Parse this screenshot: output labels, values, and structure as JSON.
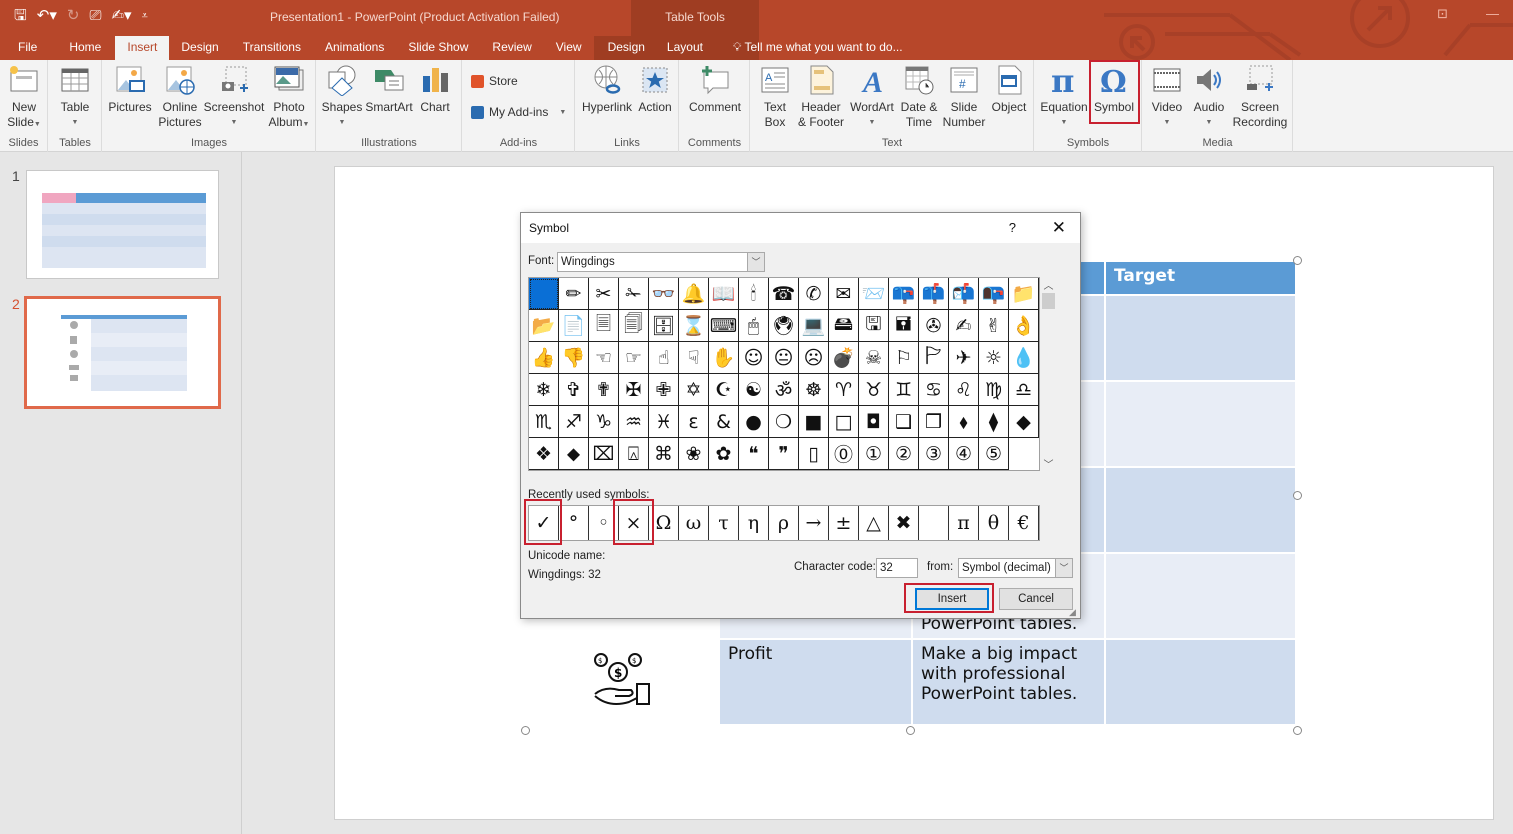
{
  "window": {
    "title": "Presentation1 - PowerPoint (Product Activation Failed)",
    "contextual_group": "Table Tools",
    "accent_color": "#b7472a"
  },
  "quick_access": [
    "save-icon",
    "undo-icon",
    "redo-icon",
    "start-from-beginning-icon",
    "touch-mode-icon",
    "customize-icon"
  ],
  "tabs": [
    {
      "label": "File"
    },
    {
      "label": "Home"
    },
    {
      "label": "Insert",
      "active": true
    },
    {
      "label": "Design"
    },
    {
      "label": "Transitions"
    },
    {
      "label": "Animations"
    },
    {
      "label": "Slide Show"
    },
    {
      "label": "Review"
    },
    {
      "label": "View"
    },
    {
      "label": "Design"
    },
    {
      "label": "Layout"
    }
  ],
  "tell_me": "Tell me what you want to do...",
  "ribbon": {
    "groups": {
      "slides": "Slides",
      "tables": "Tables",
      "images": "Images",
      "illustrations": "Illustrations",
      "addins": "Add-ins",
      "links": "Links",
      "comments": "Comments",
      "text": "Text",
      "symbols": "Symbols",
      "media": "Media"
    },
    "buttons": {
      "new_slide": [
        "New",
        "Slide"
      ],
      "table": "Table",
      "pictures": "Pictures",
      "online_pictures": [
        "Online",
        "Pictures"
      ],
      "screenshot": "Screenshot",
      "photo_album": [
        "Photo",
        "Album"
      ],
      "shapes": "Shapes",
      "smartart": "SmartArt",
      "chart": "Chart",
      "store": "Store",
      "my_addins": "My Add-ins",
      "hyperlink": "Hyperlink",
      "action": "Action",
      "comment": "Comment",
      "text_box": [
        "Text",
        "Box"
      ],
      "header_footer": [
        "Header",
        "& Footer"
      ],
      "wordart": "WordArt",
      "date_time": [
        "Date &",
        "Time"
      ],
      "slide_number": [
        "Slide",
        "Number"
      ],
      "object": "Object",
      "equation": "Equation",
      "symbol": "Symbol",
      "video": "Video",
      "audio": "Audio",
      "screen_recording": [
        "Screen",
        "Recording"
      ]
    }
  },
  "slides_pane": {
    "slides": [
      {
        "number": "1"
      },
      {
        "number": "2",
        "selected": true
      }
    ]
  },
  "slide_table": {
    "header": [
      "",
      "",
      "",
      "Target"
    ],
    "rows": [
      {
        "icon": "",
        "label": "",
        "desc": "."
      },
      {
        "icon": "",
        "label": "",
        "desc": "."
      },
      {
        "icon": "",
        "label": "",
        "desc": "."
      },
      {
        "icon": "",
        "label": "",
        "desc": "PowerPoint tables."
      },
      {
        "icon": "hand-money-icon",
        "label": "Profit",
        "desc": "Make a big impact with professional PowerPoint tables."
      }
    ]
  },
  "dialog": {
    "title": "Symbol",
    "help": "?",
    "font_label": "Font:",
    "font_value": "Wingdings",
    "symbols": [
      " ",
      "✏",
      "✂",
      "✁",
      "👓",
      "🔔",
      "📖",
      "🕯",
      "☎",
      "✆",
      "✉",
      "📨",
      "📪",
      "📫",
      "📬",
      "📭",
      "📁",
      "📂",
      "📄",
      "🗏",
      "🗐",
      "🗄",
      "⌛",
      "⌨",
      "🖱",
      "🖲",
      "💻",
      "🖴",
      "🖫",
      "🖬",
      "✇",
      "✍",
      "✌",
      "👌",
      "👍",
      "👎",
      "☜",
      "☞",
      "☝",
      "☟",
      "✋",
      "☺",
      "😐",
      "☹",
      "💣",
      "☠",
      "⚐",
      "🏱",
      "✈",
      "☼",
      "💧",
      "❄",
      "✞",
      "✟",
      "✠",
      "✙",
      "✡",
      "☪",
      "☯",
      "ॐ",
      "☸",
      "♈",
      "♉",
      "♊",
      "♋",
      "♌",
      "♍",
      "♎",
      "♏",
      "♐",
      "♑",
      "♒",
      "♓",
      "ɛ",
      "&",
      "●",
      "❍",
      "■",
      "□",
      "◘",
      "❑",
      "❒",
      "⬧",
      "⧫",
      "◆",
      "❖",
      "⬥",
      "⌧",
      "⍓",
      "⌘",
      "❀",
      "✿",
      "❝",
      "❞",
      "▯",
      "⓪",
      "①",
      "②",
      "③",
      "④",
      "⑤"
    ],
    "recent_label": "Recently used symbols:",
    "recent": [
      "✓",
      "°",
      "◦",
      "×",
      "Ω",
      "ω",
      "τ",
      "η",
      "ρ",
      "→",
      "±",
      "△",
      "✖",
      " ",
      "π",
      "θ",
      "€"
    ],
    "unicode_name_label": "Unicode name:",
    "unicode_name_value": "Wingdings: 32",
    "char_code_label": "Character code:",
    "char_code_value": "32",
    "from_label": "from:",
    "from_value": "Symbol (decimal)",
    "insert": "Insert",
    "cancel": "Cancel"
  }
}
